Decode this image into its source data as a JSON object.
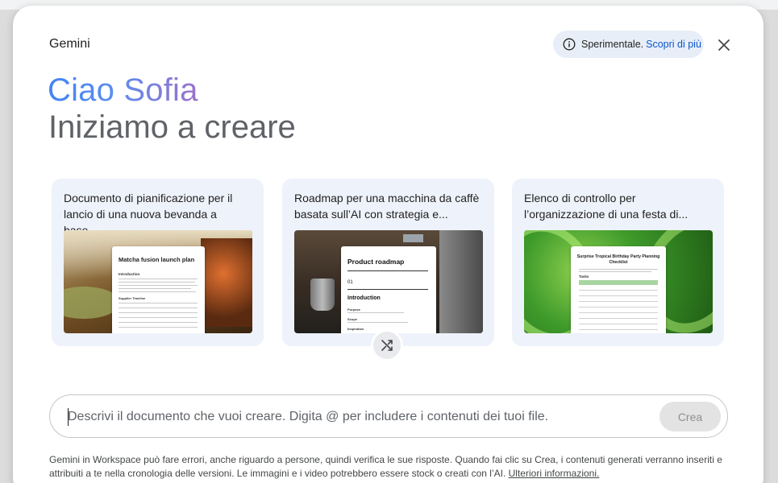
{
  "dialog": {
    "brand": "Gemini",
    "experimental": {
      "label": "Sperimentale.",
      "link": "Scopri di più"
    },
    "greeting": "Ciao Sofia",
    "subtitle": "Iniziamo a creare"
  },
  "cards": [
    {
      "title": "Documento di pianificazione per il lancio di una nuova bevanda a base...",
      "doc_title": "Matcha fusion launch plan",
      "doc_heading": "Introduction",
      "doc_section": "Supplier Timeline"
    },
    {
      "title": "Roadmap per una macchina da caffè basata sull’AI con strategia e...",
      "doc_title": "Product roadmap",
      "doc_number": "01",
      "doc_heading": "Introduction",
      "doc_labels": [
        "Purpose",
        "Scope",
        "Inspiration"
      ]
    },
    {
      "title": "Elenco di controllo per l’organizzazione di una festa di...",
      "doc_title": "Surprise Tropical Birthday Party Planning Checklist",
      "doc_section": "Tasks"
    }
  ],
  "prompt": {
    "placeholder": "Descrivi il documento che vuoi creare. Digita @ per includere i contenuti dei tuoi file.",
    "submit_label": "Crea"
  },
  "disclaimer": {
    "text": "Gemini in Workspace può fare errori, anche riguardo a persone, quindi verifica le sue risposte. Quando fai clic su Crea, i contenuti generati verranno inseriti e attribuiti a te nella cronologia delle versioni. Le immagini e i video potrebbero essere stock o creati con l’AI. ",
    "link": "Ulteriori informazioni."
  },
  "colors": {
    "accent": "#0b57d0",
    "card_bg": "#eef2fa",
    "chip_bg": "#e8eef7"
  },
  "icons": [
    "info-icon",
    "close-icon",
    "shuffle-icon"
  ]
}
